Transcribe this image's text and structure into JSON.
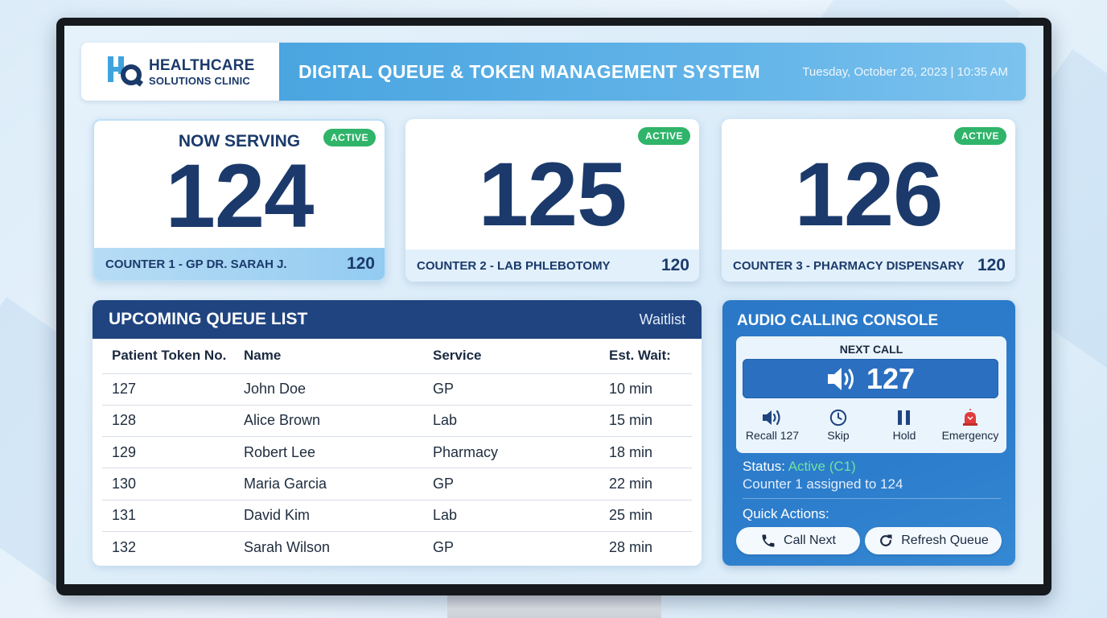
{
  "header": {
    "logo_line1": "HEALTHCARE",
    "logo_line2": "SOLUTIONS CLINIC",
    "title": "DIGITAL QUEUE & TOKEN MANAGEMENT SYSTEM",
    "datetime": "Tuesday, October 26, 2023 | 10:35 AM"
  },
  "counters": [
    {
      "heading": "NOW SERVING",
      "token": "124",
      "badge": "ACTIVE",
      "label": "COUNTER 1 - GP DR. SARAH J.",
      "number": "120"
    },
    {
      "token": "125",
      "badge": "ACTIVE",
      "label": "COUNTER 2 - LAB PHLEBOTOMY",
      "number": "120"
    },
    {
      "token": "126",
      "badge": "ACTIVE",
      "label": "COUNTER 3 - PHARMACY DISPENSARY",
      "number": "120"
    }
  ],
  "queue": {
    "title": "UPCOMING QUEUE LIST",
    "subtitle": "Waitlist",
    "columns": [
      "Patient Token No.",
      "Name",
      "Service",
      "Est. Wait:"
    ],
    "rows": [
      [
        "127",
        "John Doe",
        "GP",
        "10 min"
      ],
      [
        "128",
        "Alice Brown",
        "Lab",
        "15 min"
      ],
      [
        "129",
        "Robert Lee",
        "Pharmacy",
        "18 min"
      ],
      [
        "130",
        "Maria Garcia",
        "GP",
        "22 min"
      ],
      [
        "131",
        "David Kim",
        "Lab",
        "25 min"
      ],
      [
        "132",
        "Sarah Wilson",
        "GP",
        "28 min"
      ]
    ]
  },
  "console": {
    "title": "AUDIO CALLING CONSOLE",
    "next_label": "NEXT CALL",
    "next_token": "127",
    "actions": [
      "Recall 127",
      "Skip",
      "Hold",
      "Emergency"
    ],
    "status_label": "Status:",
    "status_value": "Active (C1)",
    "assigned": "Counter 1 assigned to 124",
    "quick_label": "Quick Actions:",
    "call_next": "Call Next",
    "refresh": "Refresh Queue"
  },
  "colors": {
    "navy": "#1b3a6b",
    "header_blue": "#4aa5e0",
    "console_blue": "#2b78c8",
    "active_green": "#2fb46a",
    "emergency_red": "#e23b3b"
  }
}
